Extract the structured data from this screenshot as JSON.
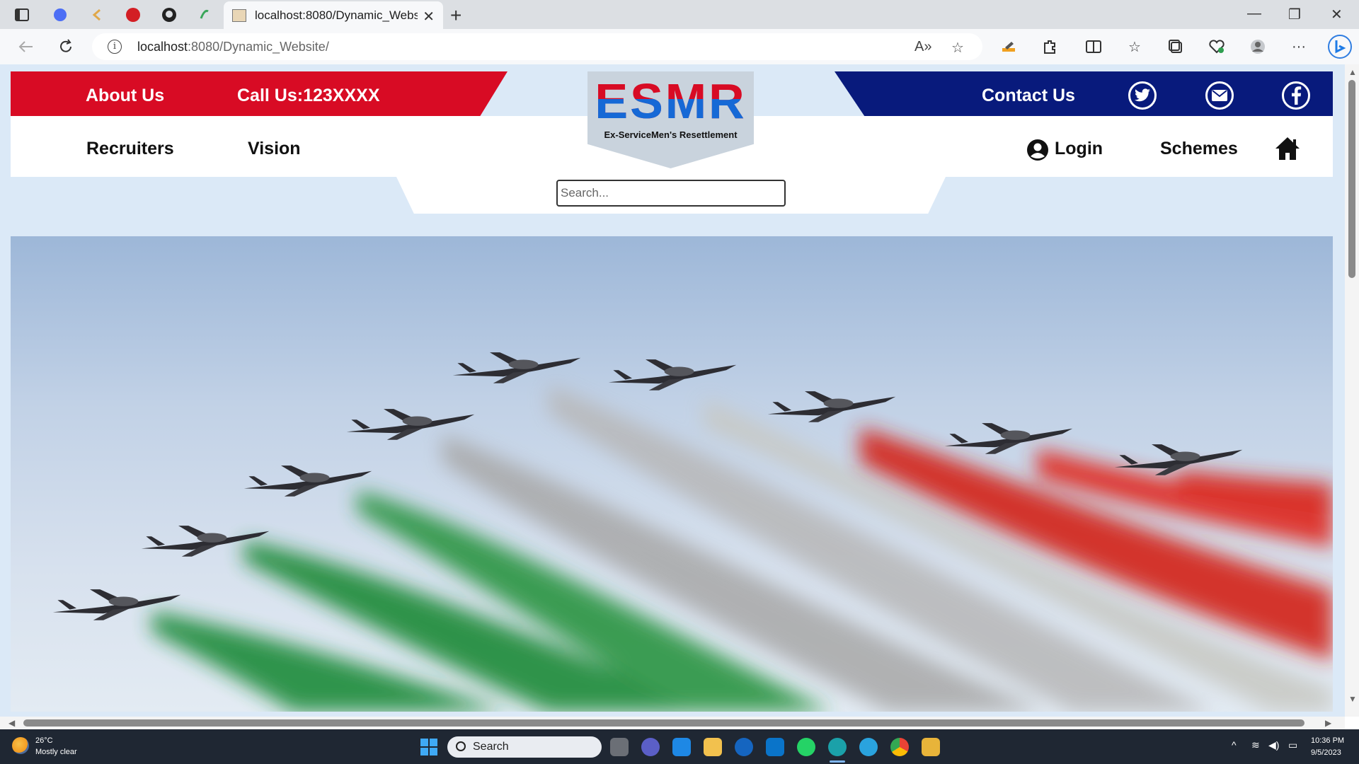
{
  "browser": {
    "tab_title": "localhost:8080/Dynamic_Website",
    "new_tab": "+",
    "url_host": "localhost",
    "url_rest": ":8080/Dynamic_Website/",
    "window_controls": {
      "minimize": "—",
      "restore": "❐",
      "close": "✕"
    }
  },
  "site": {
    "top_left": {
      "about": "About Us",
      "call": "Call Us:123XXXX"
    },
    "top_right": {
      "contact": "Contact Us"
    },
    "nav_left": [
      "Recruiters",
      "Vision"
    ],
    "nav_right": {
      "login": "Login",
      "schemes": "Schemes"
    },
    "logo": {
      "word": "ESMR",
      "subtitle": "Ex-ServiceMen's Resettlement"
    },
    "search": {
      "placeholder": "Search..."
    },
    "social_icons": [
      "twitter-icon",
      "mail-icon",
      "facebook-icon"
    ],
    "colors": {
      "red": "#d80b24",
      "navy": "#081a7c",
      "band_bg": "#dbe9f7"
    }
  },
  "taskbar": {
    "weather": {
      "temp": "26°C",
      "desc": "Mostly clear"
    },
    "search": "Search",
    "time": "10:36 PM",
    "date": "9/5/2023"
  }
}
